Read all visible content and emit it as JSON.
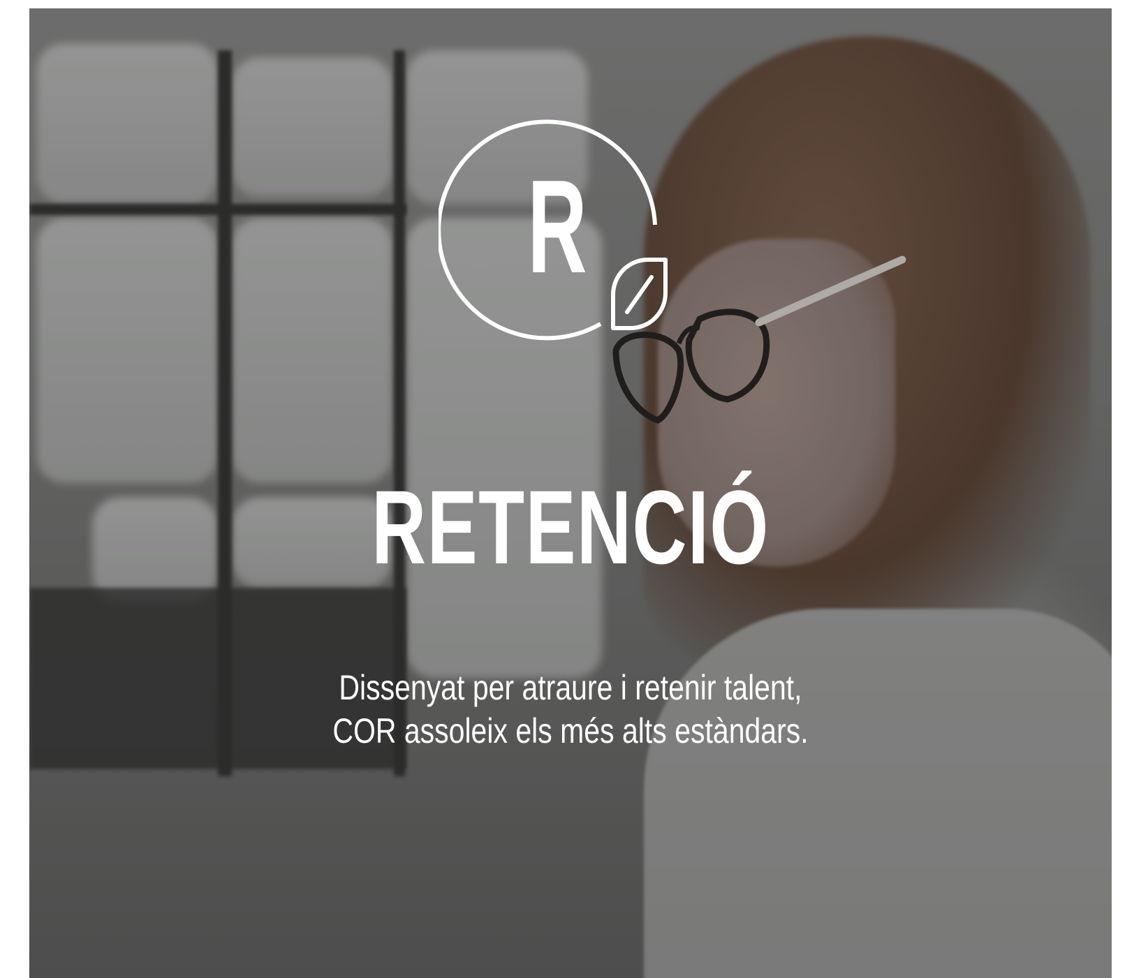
{
  "hero": {
    "logo_letter": "R",
    "title": "RETENCIÓ",
    "subtitle_line1": "Dissenyat per atraure i retenir talent,",
    "subtitle_line2": "COR assoleix els més alts estàndars."
  },
  "icons": {
    "logo": "r-leaf-circle-icon"
  },
  "colors": {
    "text": "#ffffff",
    "page_background": "#ffffff",
    "overlay": "#282828"
  }
}
